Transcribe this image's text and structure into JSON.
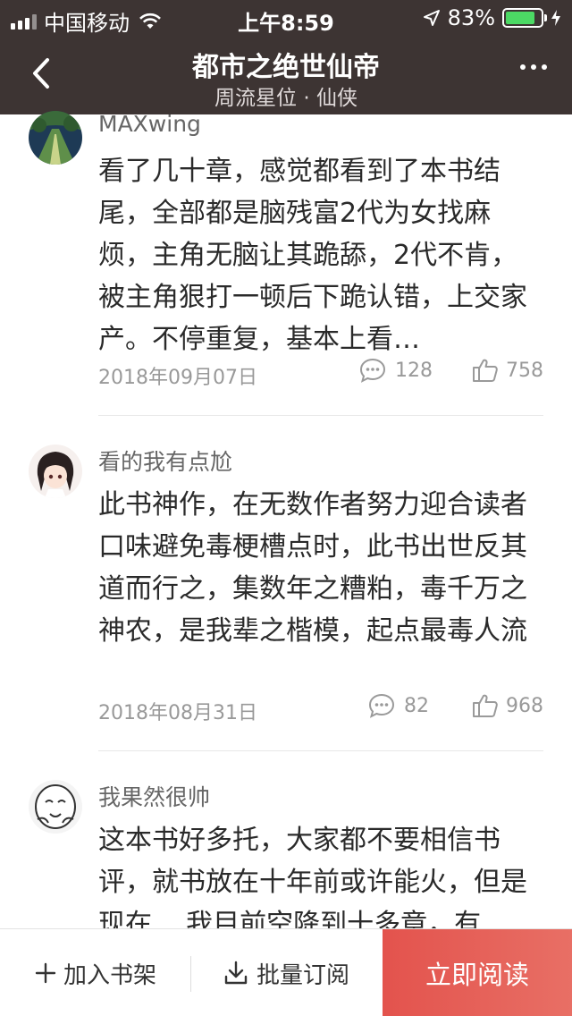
{
  "status_bar": {
    "carrier": "中国移动",
    "time": "上午8:59",
    "battery": "83%",
    "battery_level": 0.83
  },
  "nav": {
    "title": "都市之绝世仙帝",
    "subtitle": "周流星位 · 仙侠"
  },
  "comments": [
    {
      "username": "MAXwing",
      "text": "看了几十章，感觉都看到了本书结尾，全部都是脑残富2代为女找麻烦，主角无脑让其跪舔，2代不肯，被主角狠打一顿后下跪认错，上交家产。不停重复，基本上看…",
      "date": "2018年09月07日",
      "replies": "128",
      "likes": "758"
    },
    {
      "username": "看的我有点尬",
      "text": "此书神作，在无数作者努力迎合读者口味避免毒梗槽点时，此书出世反其道而行之，集数年之糟粕，毒千万之神农，是我辈之楷模，起点最毒人流",
      "date": "2018年08月31日",
      "replies": "82",
      "likes": "968"
    },
    {
      "username": "我果然很帅",
      "text": "这本书好多托，大家都不要相信书评，就书放在十年前或许能火，但是现在....我目前空降到十多章，有"
    }
  ],
  "bottom_bar": {
    "add_label": "加入书架",
    "batch_label": "批量订阅",
    "read_label": "立即阅读"
  },
  "colors": {
    "header_bg": "#3d3433",
    "accent": "#e3534d"
  }
}
